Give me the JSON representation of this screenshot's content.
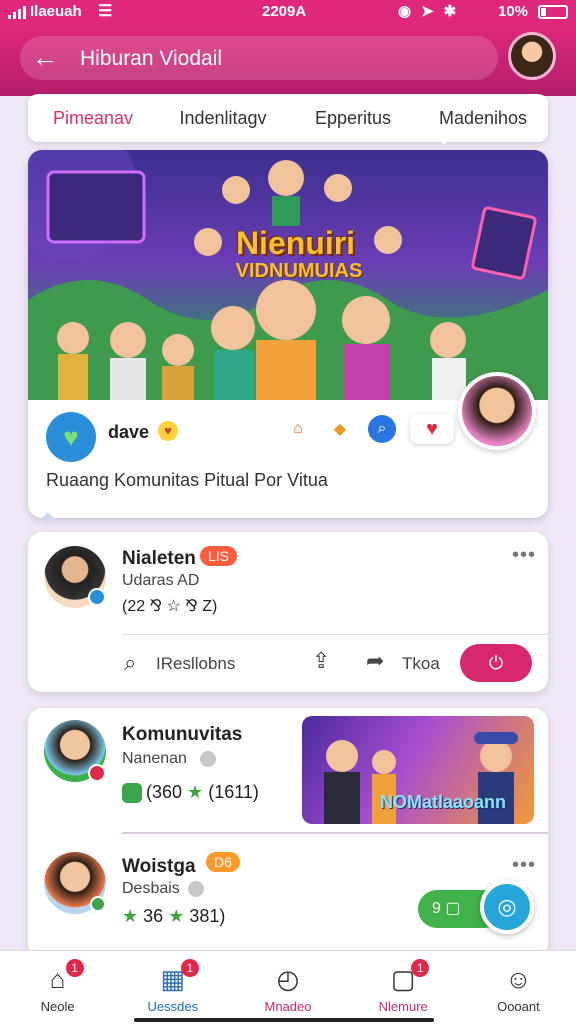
{
  "status": {
    "carrier": "Ilaeuah",
    "time": "2209A",
    "battery": "10%"
  },
  "header": {
    "title": "Hiburan Viodail"
  },
  "tabs": [
    {
      "label": "Pimeanav"
    },
    {
      "label": "Indenlitagv"
    },
    {
      "label": "Epperitus"
    },
    {
      "label": "Madenihos"
    }
  ],
  "hero": {
    "title": "Nienuiri",
    "subtitle": "VIDNUMUIAS",
    "user": "dave",
    "caption": "Ruaang Komunitas Pitual Por Vitua"
  },
  "post": {
    "name": "Nialeten",
    "badge": "LIS",
    "subtitle": "Udaras AD",
    "stats": "(22 ⅋ ☆ ⅋ Z)",
    "comment_label": "IResllobns",
    "forward_label": "Tkoa"
  },
  "community": {
    "item1": {
      "name": "Komunuvitas",
      "subtitle": "Nanenan",
      "stats": "(360",
      "stats2": "(1611)",
      "thumb_label": "NOMatlaaoann"
    },
    "item2": {
      "name": "Woistga",
      "badge": "D6",
      "subtitle": "Desbais",
      "stats": "36",
      "stats2": "381)",
      "pill_label": "9 ▢"
    }
  },
  "bottom_nav": [
    {
      "label": "Neole",
      "icon": "home-icon",
      "badge": "1"
    },
    {
      "label": "Uessdes",
      "icon": "calendar-icon",
      "badge": "1"
    },
    {
      "label": "Mnadeo",
      "icon": "activity-icon",
      "badge": ""
    },
    {
      "label": "Nlemure",
      "icon": "notification-icon",
      "badge": "1"
    },
    {
      "label": "Oooant",
      "icon": "profile-icon",
      "badge": ""
    }
  ],
  "colors": {
    "accent": "#e0287a",
    "active_tab": "#e33063",
    "nav_active": "#1b6fb4"
  }
}
